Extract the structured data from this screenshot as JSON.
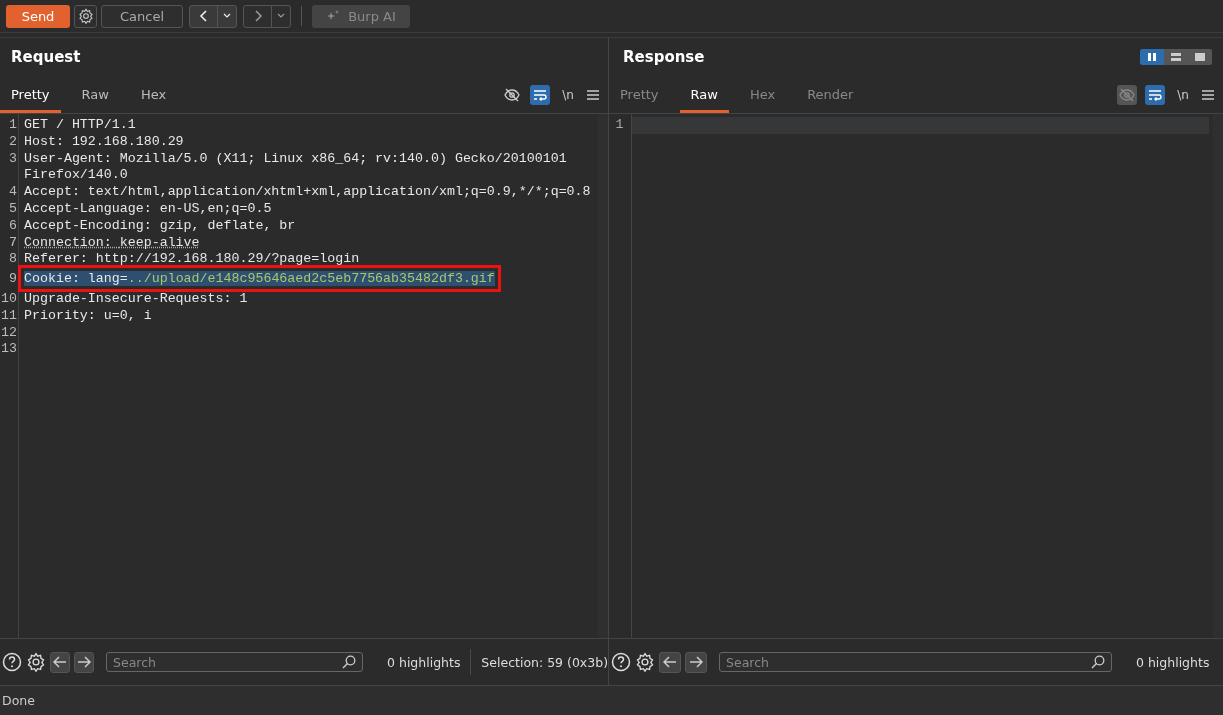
{
  "toolbar": {
    "send": "Send",
    "cancel": {
      "label": "Cancel",
      "disabled": true
    },
    "back": {
      "disabled": false
    },
    "forward": {
      "disabled": true
    },
    "ai": {
      "label": "Burp AI",
      "disabled": true
    }
  },
  "panels": [
    {
      "title": "Request",
      "tabs": [
        {
          "label": "Pretty",
          "selected": true
        },
        {
          "label": "Raw",
          "selected": false
        },
        {
          "label": "Hex",
          "selected": false
        }
      ],
      "tools": [
        {
          "kind": "eye",
          "on": false,
          "disabled": false
        },
        {
          "kind": "wrap",
          "on": true,
          "disabled": false
        },
        {
          "kind": "newline",
          "label": "\\n",
          "on": false,
          "disabled": false
        },
        {
          "kind": "menu",
          "on": false,
          "disabled": false
        }
      ],
      "lines": [
        {
          "number": "1",
          "value": "GET / HTTP/1.1",
          "selected": false,
          "underlined": false,
          "boxed": false
        },
        {
          "number": "2",
          "name": "Host:",
          "value": "192.168.180.29",
          "selected": false,
          "underlined": false,
          "boxed": false
        },
        {
          "number": "3",
          "name": "User-Agent:",
          "value": "Mozilla/5.0 (X11; Linux x86_64; rv:140.0) Gecko/20100101 Firefox/140.0",
          "selected": false,
          "underlined": false,
          "boxed": false
        },
        {
          "number": "4",
          "name": "Accept:",
          "value": "text/html,application/xhtml+xml,application/xml;q=0.9,*/*;q=0.8",
          "selected": false,
          "underlined": false,
          "boxed": false
        },
        {
          "number": "5",
          "name": "Accept-Language:",
          "value": "en-US,en;q=0.5",
          "selected": false,
          "underlined": false,
          "boxed": false
        },
        {
          "number": "6",
          "name": "Accept-Encoding:",
          "value": "gzip, deflate, br",
          "selected": false,
          "underlined": false,
          "boxed": false
        },
        {
          "number": "7",
          "name": "Connection:",
          "value": "keep-alive",
          "selected": false,
          "underlined": true,
          "boxed": false
        },
        {
          "number": "8",
          "name": "Referer:",
          "value": "http://192.168.180.29/?page=login",
          "selected": false,
          "underlined": false,
          "boxed": false
        },
        {
          "number": "9",
          "name": "Cookie:",
          "value": "lang=",
          "path": "../upload/e148c95646aed2c5eb7756ab35482df3.gif",
          "selected": true,
          "underlined": false,
          "boxed": true
        },
        {
          "number": "10",
          "name": "Upgrade-Insecure-Requests:",
          "value": "1",
          "selected": false,
          "underlined": false,
          "boxed": false
        },
        {
          "number": "11",
          "name": "Priority:",
          "value": "u=0, i",
          "selected": false,
          "underlined": false,
          "boxed": false
        },
        {
          "number": "12"
        },
        {
          "number": "13"
        }
      ],
      "search": {
        "placeholder": "Search"
      },
      "highlights": "0 highlights",
      "selection": "Selection: 59 (0x3b)"
    },
    {
      "title": "Response",
      "layout_toggle": [
        {
          "kind": "columns",
          "selected": true
        },
        {
          "kind": "rows",
          "selected": false
        },
        {
          "kind": "single",
          "selected": false
        }
      ],
      "tabs": [
        {
          "label": "Pretty",
          "selected": false
        },
        {
          "label": "Raw",
          "selected": true
        },
        {
          "label": "Hex",
          "selected": false
        },
        {
          "label": "Render",
          "selected": false
        }
      ],
      "tools": [
        {
          "kind": "eye",
          "on": false,
          "disabled": true
        },
        {
          "kind": "wrap",
          "on": true,
          "disabled": false
        },
        {
          "kind": "newline",
          "label": "\\n",
          "on": false,
          "disabled": false
        },
        {
          "kind": "menu",
          "on": false,
          "disabled": false
        }
      ],
      "lines": [
        {
          "number": "1",
          "current": true
        }
      ],
      "search": {
        "placeholder": "Search"
      },
      "highlights": "0 highlights"
    }
  ],
  "status": "Done"
}
